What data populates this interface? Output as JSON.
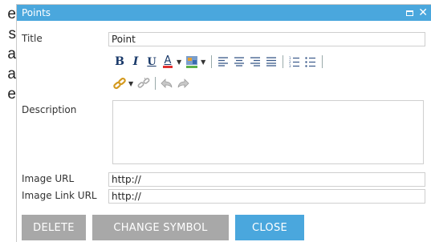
{
  "background": {
    "letters": [
      "e",
      "s",
      "a",
      "a",
      "e"
    ]
  },
  "dialog": {
    "title": "Points",
    "controls": {
      "maximize_icon": "maximize-icon",
      "close_icon": "close-icon"
    },
    "colors": {
      "titlebar": "#4aa7dd",
      "button_gray": "#a8a8a8",
      "button_blue": "#4aa7dd"
    }
  },
  "form": {
    "title_label": "Title",
    "title_value": "Point",
    "description_label": "Description",
    "description_value": "",
    "image_url_label": "Image URL",
    "image_url_value": "http://",
    "image_link_url_label": "Image Link URL",
    "image_link_url_value": "http://"
  },
  "toolbar": {
    "bold": "B",
    "italic": "I",
    "underline": "U",
    "font_color": "A",
    "icons": [
      "bold-icon",
      "italic-icon",
      "underline-icon",
      "font-color-icon",
      "highlight-color-icon",
      "align-left-icon",
      "align-center-icon",
      "align-right-icon",
      "justify-icon",
      "numbered-list-icon",
      "bulleted-list-icon",
      "link-icon",
      "unlink-icon",
      "undo-icon",
      "redo-icon"
    ]
  },
  "buttons": {
    "delete": "DELETE",
    "change_symbol": "CHANGE SYMBOL",
    "close": "CLOSE"
  }
}
